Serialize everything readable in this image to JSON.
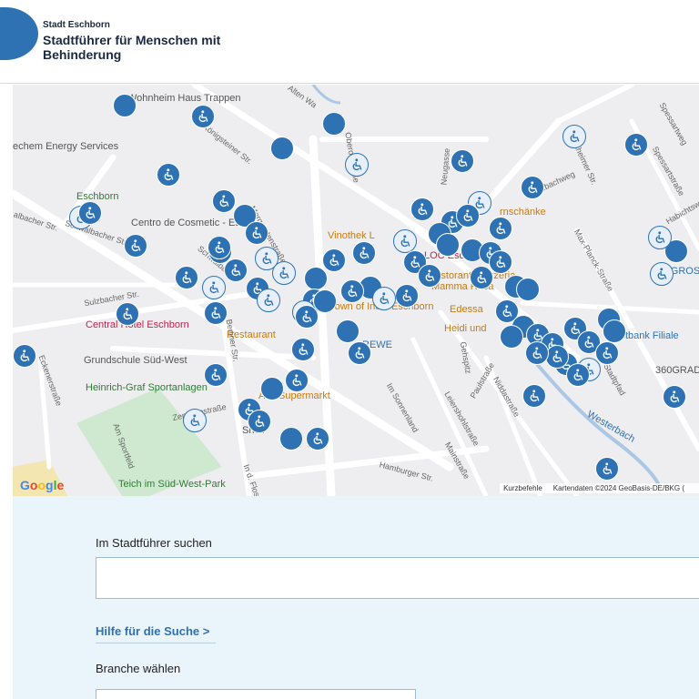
{
  "header": {
    "org_name": "Stadt Eschborn",
    "title": "Stadtführer für Menschen mit Behinderung",
    "brand_color": "#2e72b3"
  },
  "map": {
    "labels": {
      "wohnheim": "Wohnheim Haus Trappen",
      "energy": "echem Energy Services",
      "cosmetic": "Centro de Cosmetic - Es",
      "hotel": "Central Hotel Eschborn",
      "grundschule": "Grundschule Süd-West",
      "sportanlagen": "Heinrich-Graf Sportanlagen",
      "teich": "Teich im Süd-West-Park",
      "eschborn_s": "Eschborn",
      "restaurant": "Restaurant",
      "alfa": "Alfa Supermarkt",
      "shell": "Shell",
      "crown": "Crown of India Eschborn",
      "rewe": "REWE",
      "vinothek": "Vinothek L",
      "loc": "LOC Esch",
      "pizzeria": "Ristorante Pizzeria Mamma Rosa",
      "edessa": "Edessa",
      "heidi": "Heidi und",
      "schaenke": "rnschänke",
      "postbank": "Postbank Filiale",
      "selgros": "SELGROS",
      "grad": "360GRAD",
      "westerbach": "Westerbach"
    },
    "streets": {
      "koenigsteiner": "Königsteiner Str.",
      "hauptstr": "Hauptstr.",
      "schwalbacher1": "albacher Str.",
      "schwalbacher2": "Schwalbacher Str.",
      "schwalbacher3": "Schwalbacher",
      "margareten": "Margaretenstraße",
      "berliner": "Berliner Str.",
      "ottoerber": "Oberortstraße",
      "neugasse": "Neugasse",
      "sulzbacher": "Sulzbacher Str.",
      "eckener": "Eckenerstraße",
      "zeppelin": "Zeppelinstraße",
      "sportfeld": "Am Sportfeld",
      "hamburger": "Hamburger Str.",
      "floss": "In d. Flos",
      "sonnenland": "Im Sonnenland",
      "leiershohl": "Leiershohlstraße",
      "mainstrasse": "Mainstraße",
      "nidda": "Niddastraße",
      "paul": "Paulstraße",
      "gehspitz": "Gehspitz",
      "stadtpfad": "Am Stadtpfad",
      "maxplanck": "Max-Planck-Straße",
      "roedelheimer": "Rödelheimer Str.",
      "spessart": "Spessartweg",
      "spessartstr": "Spessartstraße",
      "habichtsweg": "Habichtsweg",
      "alten": "Alten Wa",
      "kurzbach": "Kurzbachweg"
    },
    "attribution": {
      "shortcuts": "Kurzbefehle",
      "data": "Kartendaten ©2024 GeoBasis-DE/BKG (",
      "google": "Google"
    },
    "marker_color": "#2e72b3",
    "marker_icon": "wheelchair-icon"
  },
  "search": {
    "label": "Im Stadtführer suchen",
    "input_value": "",
    "placeholder": "",
    "help_link": "Hilfe für die Suche >",
    "branch_label": "Branche wählen",
    "branch_value": ""
  }
}
